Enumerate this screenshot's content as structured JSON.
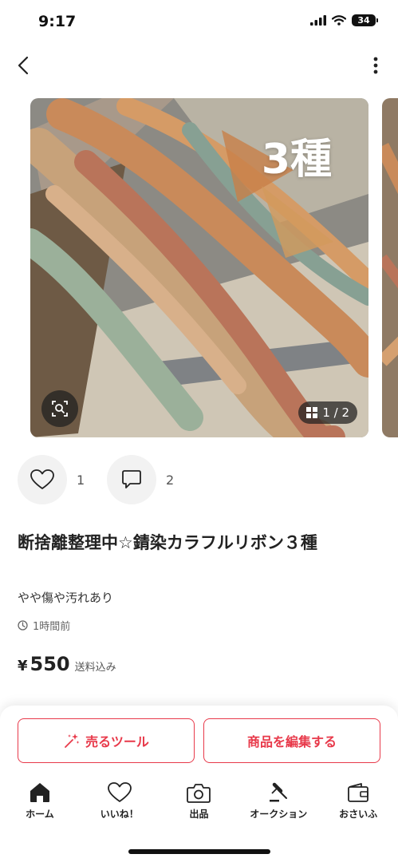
{
  "status_bar": {
    "time": "9:17",
    "battery": "34"
  },
  "header": {
    "back_icon": "chevron-left-icon",
    "menu_icon": "more-vertical-icon"
  },
  "gallery": {
    "overlay_text": "3種",
    "page_indicator": "1 / 2",
    "current_page": 1,
    "total_pages": 2
  },
  "social": {
    "likes": "1",
    "comments": "2"
  },
  "product": {
    "title": "断捨離整理中☆錆染カラフルリボン３種",
    "condition": "やや傷や汚れあり",
    "posted": "1時間前",
    "currency": "¥",
    "price": "550",
    "shipping": "送料込み"
  },
  "actions": {
    "sell_tool_label": "売るツール",
    "edit_label": "商品を編集する"
  },
  "tabs": [
    {
      "label": "ホーム",
      "icon": "home-icon"
    },
    {
      "label": "いいね！",
      "icon": "heart-icon"
    },
    {
      "label": "出品",
      "icon": "camera-icon"
    },
    {
      "label": "オークション",
      "icon": "gavel-icon"
    },
    {
      "label": "おさいふ",
      "icon": "wallet-icon"
    }
  ],
  "colors": {
    "accent": "#e8394a"
  }
}
